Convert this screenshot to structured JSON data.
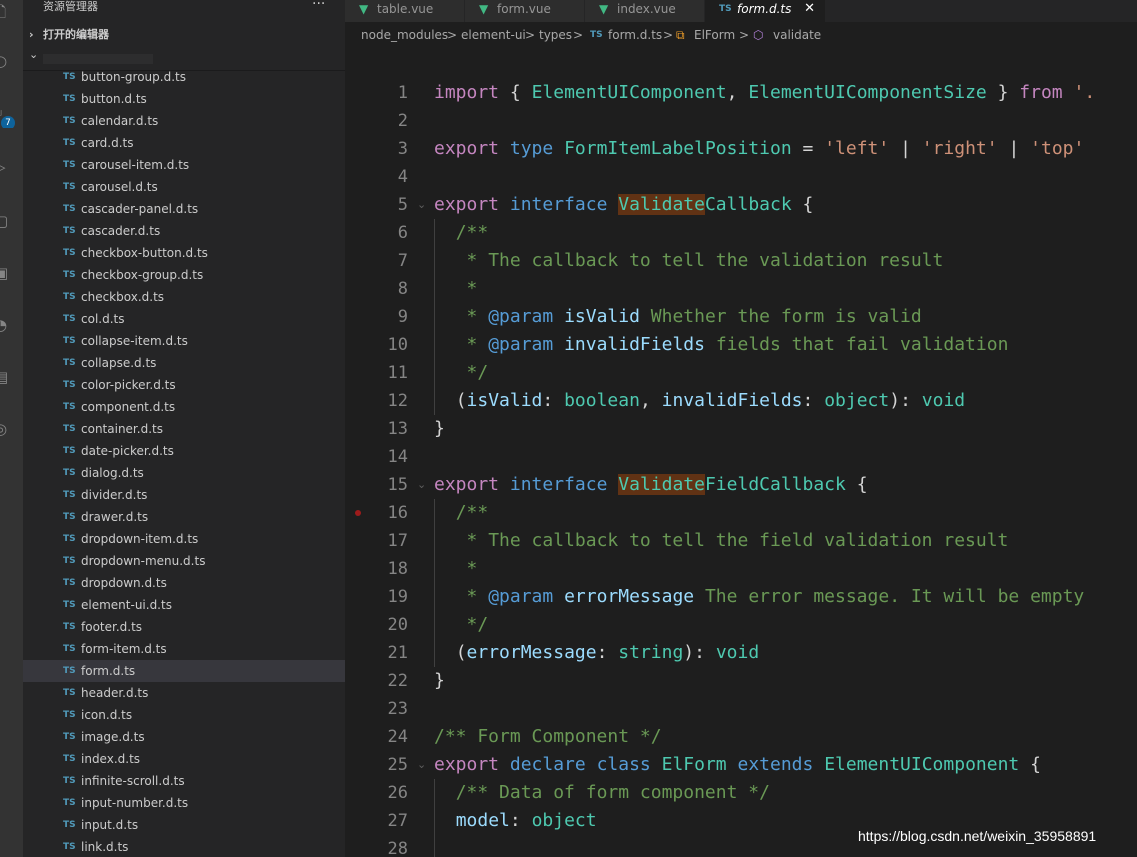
{
  "activity_bar": {
    "icons": [
      "files-icon",
      "search-icon",
      "source-control-icon",
      "run-icon",
      "remote-icon",
      "extensions-icon",
      "timeline-icon",
      "notes-icon",
      "settings-icon"
    ],
    "source_control_badge": "7"
  },
  "sidebar": {
    "title": "资源管理器",
    "more_label": "···",
    "open_editors_label": "打开的编辑器",
    "file_badge": "TS",
    "files": [
      "button-group.d.ts",
      "button.d.ts",
      "calendar.d.ts",
      "card.d.ts",
      "carousel-item.d.ts",
      "carousel.d.ts",
      "cascader-panel.d.ts",
      "cascader.d.ts",
      "checkbox-button.d.ts",
      "checkbox-group.d.ts",
      "checkbox.d.ts",
      "col.d.ts",
      "collapse-item.d.ts",
      "collapse.d.ts",
      "color-picker.d.ts",
      "component.d.ts",
      "container.d.ts",
      "date-picker.d.ts",
      "dialog.d.ts",
      "divider.d.ts",
      "drawer.d.ts",
      "dropdown-item.d.ts",
      "dropdown-menu.d.ts",
      "dropdown.d.ts",
      "element-ui.d.ts",
      "footer.d.ts",
      "form-item.d.ts",
      "form.d.ts",
      "header.d.ts",
      "icon.d.ts",
      "image.d.ts",
      "index.d.ts",
      "infinite-scroll.d.ts",
      "input-number.d.ts",
      "input.d.ts",
      "link.d.ts"
    ],
    "active_file": "form.d.ts"
  },
  "tabs": [
    {
      "label": "table.vue",
      "icon": "vue-icon",
      "active": false
    },
    {
      "label": "form.vue",
      "icon": "vue-icon",
      "active": false
    },
    {
      "label": "index.vue",
      "icon": "vue-icon",
      "active": false
    },
    {
      "label": "form.d.ts",
      "icon": "TS",
      "active": true,
      "close": "✕"
    }
  ],
  "breadcrumb": {
    "items": [
      "node_modules",
      "element-ui",
      "types",
      "form.d.ts",
      "ElForm",
      "validate"
    ],
    "separator": ">",
    "ts_badge": "TS"
  },
  "editor": {
    "line_numbers": [
      "1",
      "2",
      "3",
      "4",
      "5",
      "6",
      "7",
      "8",
      "9",
      "10",
      "11",
      "12",
      "13",
      "14",
      "15",
      "16",
      "17",
      "18",
      "19",
      "20",
      "21",
      "22",
      "23",
      "24",
      "25",
      "26",
      "27",
      "28"
    ],
    "tokens": {
      "import_kw": "import",
      "ob": "{",
      "cb": "}",
      "comma": ",",
      "from_kw": "from",
      "path_frag": "'.",
      "t_component": "ElementUIComponent",
      "t_size": "ElementUIComponentSize",
      "export_kw": "export",
      "type_kw": "type",
      "t_label_pos": "FormItemLabelPosition",
      "eq": "=",
      "s_left": "'left'",
      "pipe": "|",
      "s_right": "'right'",
      "s_top": "'top'",
      "interface_kw": "interface",
      "hl_validate": "Validate",
      "callback_rest": "Callback",
      "field_callback_rest": "FieldCallback",
      "comment_open": "/**",
      "star": "*",
      "comment_close": "*/",
      "c_desc1": "The callback to tell the validation result",
      "param_tag": "@param",
      "v_isvalid": "isValid",
      "c_isvalid": "Whether the form is valid",
      "v_invalid": "invalidFields",
      "c_invalid": "fields that fail validation",
      "lp": "(",
      "rp": ")",
      "colon": ":",
      "rp_colon": "):",
      "t_boolean": "boolean",
      "t_object": "object",
      "t_void": "void",
      "t_string": "string",
      "c_desc2": "The callback to tell the field validation result",
      "v_errmsg": "errorMessage",
      "c_errmsg": "The error message. It will be empty",
      "c_form_component": "/** Form Component */",
      "declare_kw": "declare",
      "class_kw": "class",
      "t_elform": "ElForm",
      "extends_kw": "extends",
      "c_data_of_form": "/** Data of form component */",
      "v_model": "model"
    }
  },
  "watermark": "https://blog.csdn.net/weixin_35958891",
  "colors": {
    "keyword_control": "#c586c0",
    "keyword": "#569cd6",
    "type": "#4ec9b0",
    "string": "#ce9178",
    "comment": "#6a9955",
    "variable": "#9cdcfe",
    "highlight": "#613214",
    "ts_badge": "#519aba"
  }
}
